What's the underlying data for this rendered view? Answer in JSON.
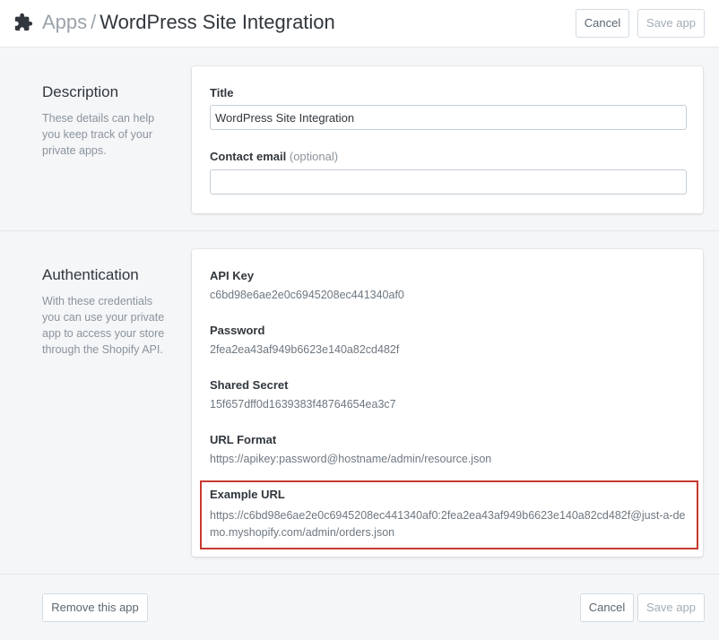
{
  "header": {
    "parent": "Apps",
    "separator": "/",
    "title": "WordPress Site Integration",
    "cancel_label": "Cancel",
    "save_label": "Save app"
  },
  "description_section": {
    "heading": "Description",
    "help": "These details can help you keep track of your private apps.",
    "title_label": "Title",
    "title_value": "WordPress Site Integration",
    "email_label": "Contact email",
    "email_optional": "(optional)",
    "email_value": ""
  },
  "auth_section": {
    "heading": "Authentication",
    "help": "With these credentials you can use your private app to access your store through the Shopify API.",
    "fields": [
      {
        "label": "API Key",
        "value": "c6bd98e6ae2e0c6945208ec441340af0"
      },
      {
        "label": "Password",
        "value": "2fea2ea43af949b6623e140a82cd482f"
      },
      {
        "label": "Shared Secret",
        "value": "15f657dff0d1639383f48764654ea3c7"
      },
      {
        "label": "URL Format",
        "value": "https://apikey:password@hostname/admin/resource.json"
      }
    ],
    "example_label": "Example URL",
    "example_value": "https://c6bd98e6ae2e0c6945208ec441340af0:2fea2ea43af949b6623e140a82cd482f@just-a-demo.myshopify.com/admin/orders.json"
  },
  "footer": {
    "remove_label": "Remove this app",
    "cancel_label": "Cancel",
    "save_label": "Save app"
  },
  "colors": {
    "highlight": "#c6392e",
    "background": "#f4f6f8"
  }
}
